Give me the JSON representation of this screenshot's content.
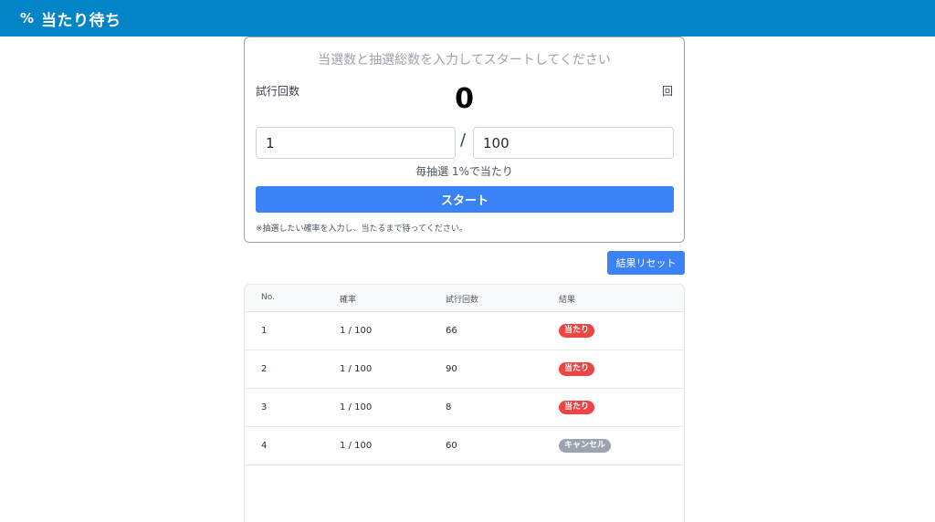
{
  "header": {
    "icon": "percent-icon",
    "icon_glyph": "%",
    "title": "当たり待ち",
    "color": "#0284c7"
  },
  "form": {
    "instruction": "当選数と抽選総数を入力してスタートしてください",
    "trial_label": "試行回数",
    "trial_count": "0",
    "trial_unit": "回",
    "win_count": "1",
    "slash": "/",
    "total_count": "100",
    "probability_text": "毎抽選 1%で当たり",
    "start_label": "スタート",
    "note": "※抽選したい確率を入力し、当たるまで待ってください。"
  },
  "reset_label": "結果リセット",
  "table": {
    "headers": [
      "No.",
      "確率",
      "試行回数",
      "結果"
    ],
    "rows": [
      {
        "no": "1",
        "prob": "1 / 100",
        "trials": "66",
        "result": "当たり",
        "status": "win"
      },
      {
        "no": "2",
        "prob": "1 / 100",
        "trials": "90",
        "result": "当たり",
        "status": "win"
      },
      {
        "no": "3",
        "prob": "1 / 100",
        "trials": "8",
        "result": "当たり",
        "status": "win"
      },
      {
        "no": "4",
        "prob": "1 / 100",
        "trials": "60",
        "result": "キャンセル",
        "status": "cancel"
      }
    ]
  },
  "colors": {
    "accent": "#3b82f6",
    "win_badge": "#ef4444",
    "cancel_badge": "#9ca3af"
  }
}
